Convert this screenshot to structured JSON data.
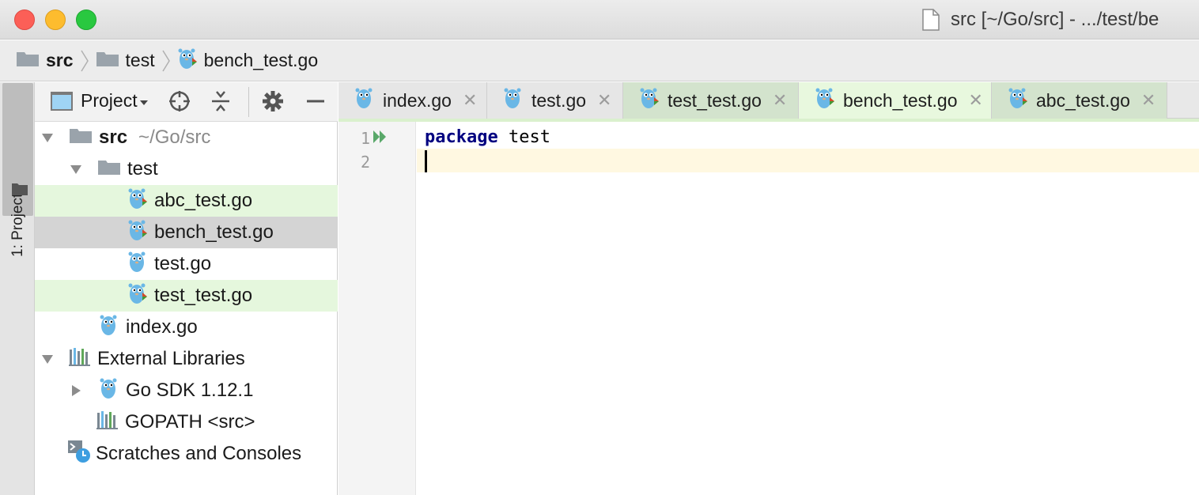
{
  "window": {
    "title": "src [~/Go/src] - .../test/be"
  },
  "breadcrumb": [
    {
      "label": "src",
      "icon": "folder-icon"
    },
    {
      "label": "test",
      "icon": "folder-icon"
    },
    {
      "label": "bench_test.go",
      "icon": "gopher-test-file-icon"
    }
  ],
  "toolstrip": {
    "project_tab_label": "1: Project"
  },
  "project_panel": {
    "title": "Project",
    "tree": [
      {
        "label": "src",
        "extra": "~/Go/src",
        "icon": "folder-icon"
      },
      {
        "label": "test",
        "icon": "folder-icon"
      },
      {
        "label": "abc_test.go",
        "icon": "gopher-test-file-icon"
      },
      {
        "label": "bench_test.go",
        "icon": "gopher-test-file-icon"
      },
      {
        "label": "test.go",
        "icon": "gopher-file-icon"
      },
      {
        "label": "test_test.go",
        "icon": "gopher-test-file-icon"
      },
      {
        "label": "index.go",
        "icon": "gopher-file-icon"
      },
      {
        "label": "External Libraries",
        "icon": "library-icon"
      },
      {
        "label": "Go SDK 1.12.1",
        "icon": "gopher-file-icon"
      },
      {
        "label": "GOPATH <src>",
        "icon": "library-icon"
      },
      {
        "label": "Scratches and Consoles",
        "icon": "scratches-icon"
      }
    ]
  },
  "editor": {
    "tabs": [
      {
        "label": "index.go"
      },
      {
        "label": "test.go"
      },
      {
        "label": "test_test.go"
      },
      {
        "label": "bench_test.go"
      },
      {
        "label": "abc_test.go"
      }
    ],
    "active_tab": "bench_test.go",
    "lines": [
      {
        "number": "1",
        "keyword": "package",
        "rest": " test"
      },
      {
        "number": "2",
        "keyword": "",
        "rest": ""
      }
    ]
  },
  "colors": {
    "test_file_highlight": "#e5f7dd",
    "selected_row": "#d4d4d4",
    "keyword": "#000080",
    "caret_line": "#fff8e1",
    "gopher_blue": "#6ab7e6"
  }
}
